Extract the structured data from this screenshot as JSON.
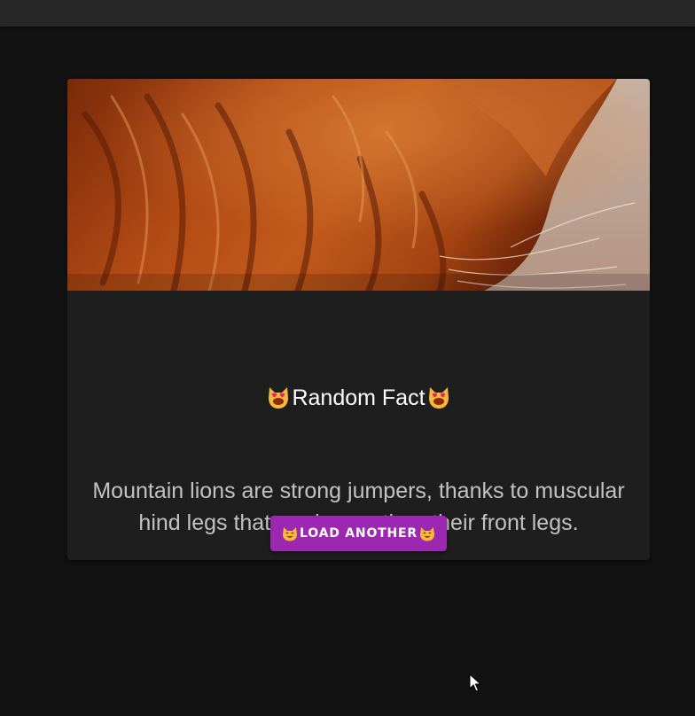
{
  "card": {
    "title": "Random Fact",
    "title_icon": "heart-eyes-cat-icon",
    "fact": "Mountain lions are strong jumpers, thanks to muscular hind legs that are longer than their front legs.",
    "image_subject": "orange tabby cat",
    "button_label": "LOAD ANOTHER",
    "button_icon": "smiling-cat-icon"
  },
  "colors": {
    "background": "#121212",
    "topbar": "#272727",
    "card": "#1e1e1e",
    "accent": "#9c27b0",
    "title_text": "#ffffff",
    "body_text": "#c2c2c2"
  }
}
